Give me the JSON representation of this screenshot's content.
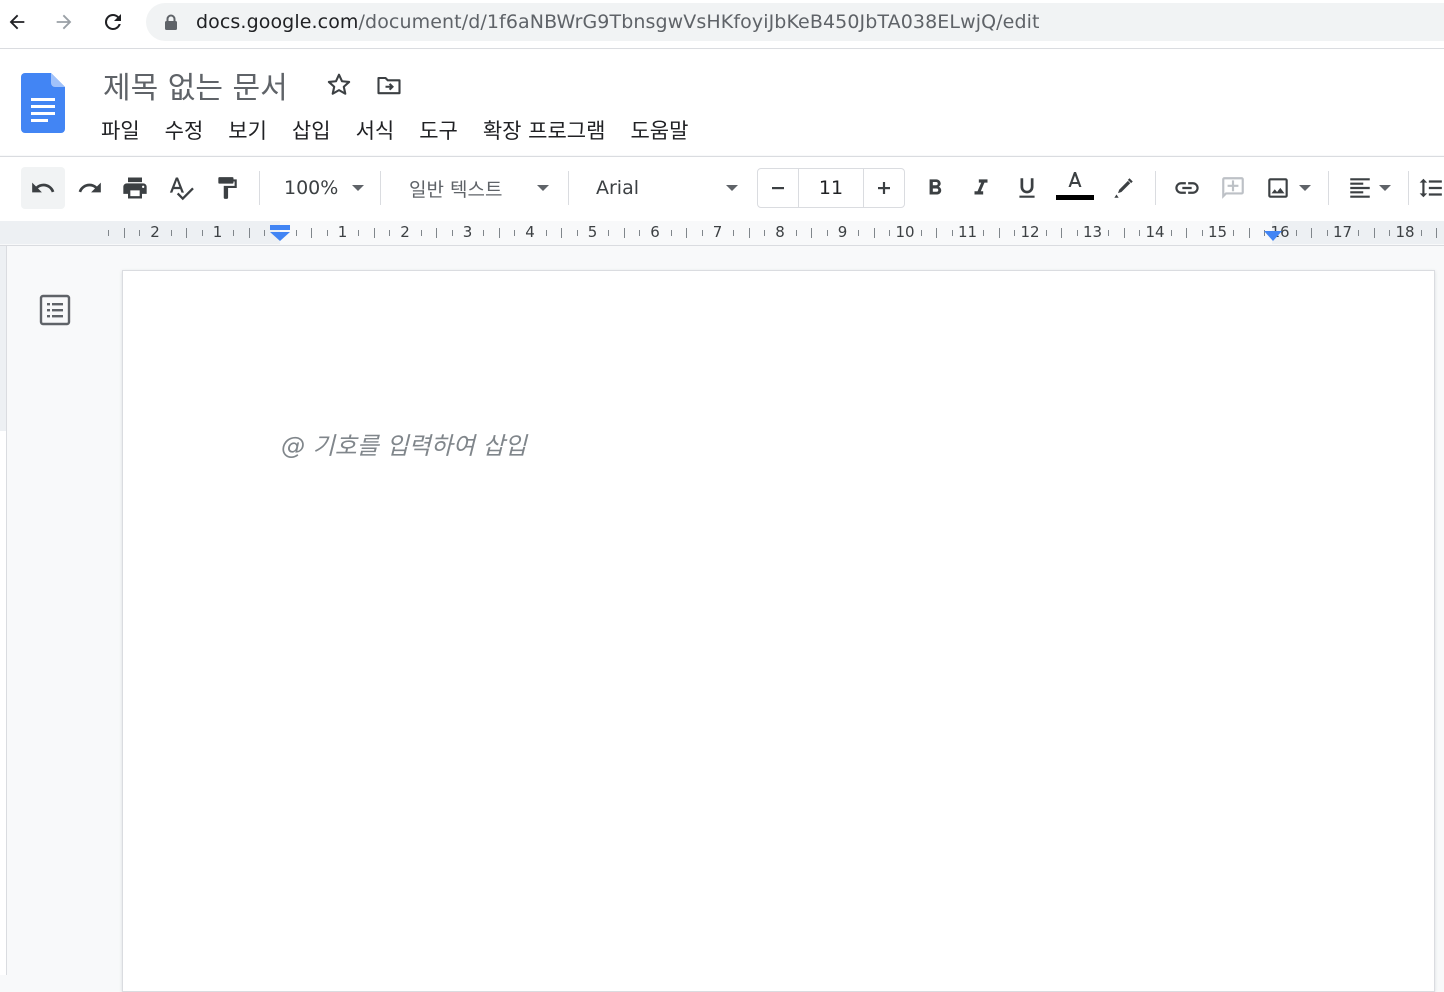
{
  "browser": {
    "url_host": "docs.google.com",
    "url_path": "/document/d/1f6aNBWrG9TbnsgwVsHKfoyiJbKeB450JbTA038ELwjQ/edit"
  },
  "doc": {
    "title": "제목 없는 문서"
  },
  "menu": [
    "파일",
    "수정",
    "보기",
    "삽입",
    "서식",
    "도구",
    "확장 프로그램",
    "도움말"
  ],
  "toolbar": {
    "zoom": "100%",
    "style": "일반 텍스트",
    "font": "Arial",
    "font_size": "11",
    "text_color": "#000000"
  },
  "ruler": {
    "left_numbers": [
      "2",
      "1"
    ],
    "numbers": [
      "1",
      "2",
      "3",
      "4",
      "5",
      "6",
      "7",
      "8",
      "9",
      "10",
      "11",
      "12",
      "13",
      "14",
      "15",
      "16",
      "17",
      "18"
    ]
  },
  "editor": {
    "placeholder": "@ 기호를 입력하여 삽입"
  },
  "colors": {
    "accent": "#1a73e8",
    "docs_blue": "#4285f4"
  }
}
